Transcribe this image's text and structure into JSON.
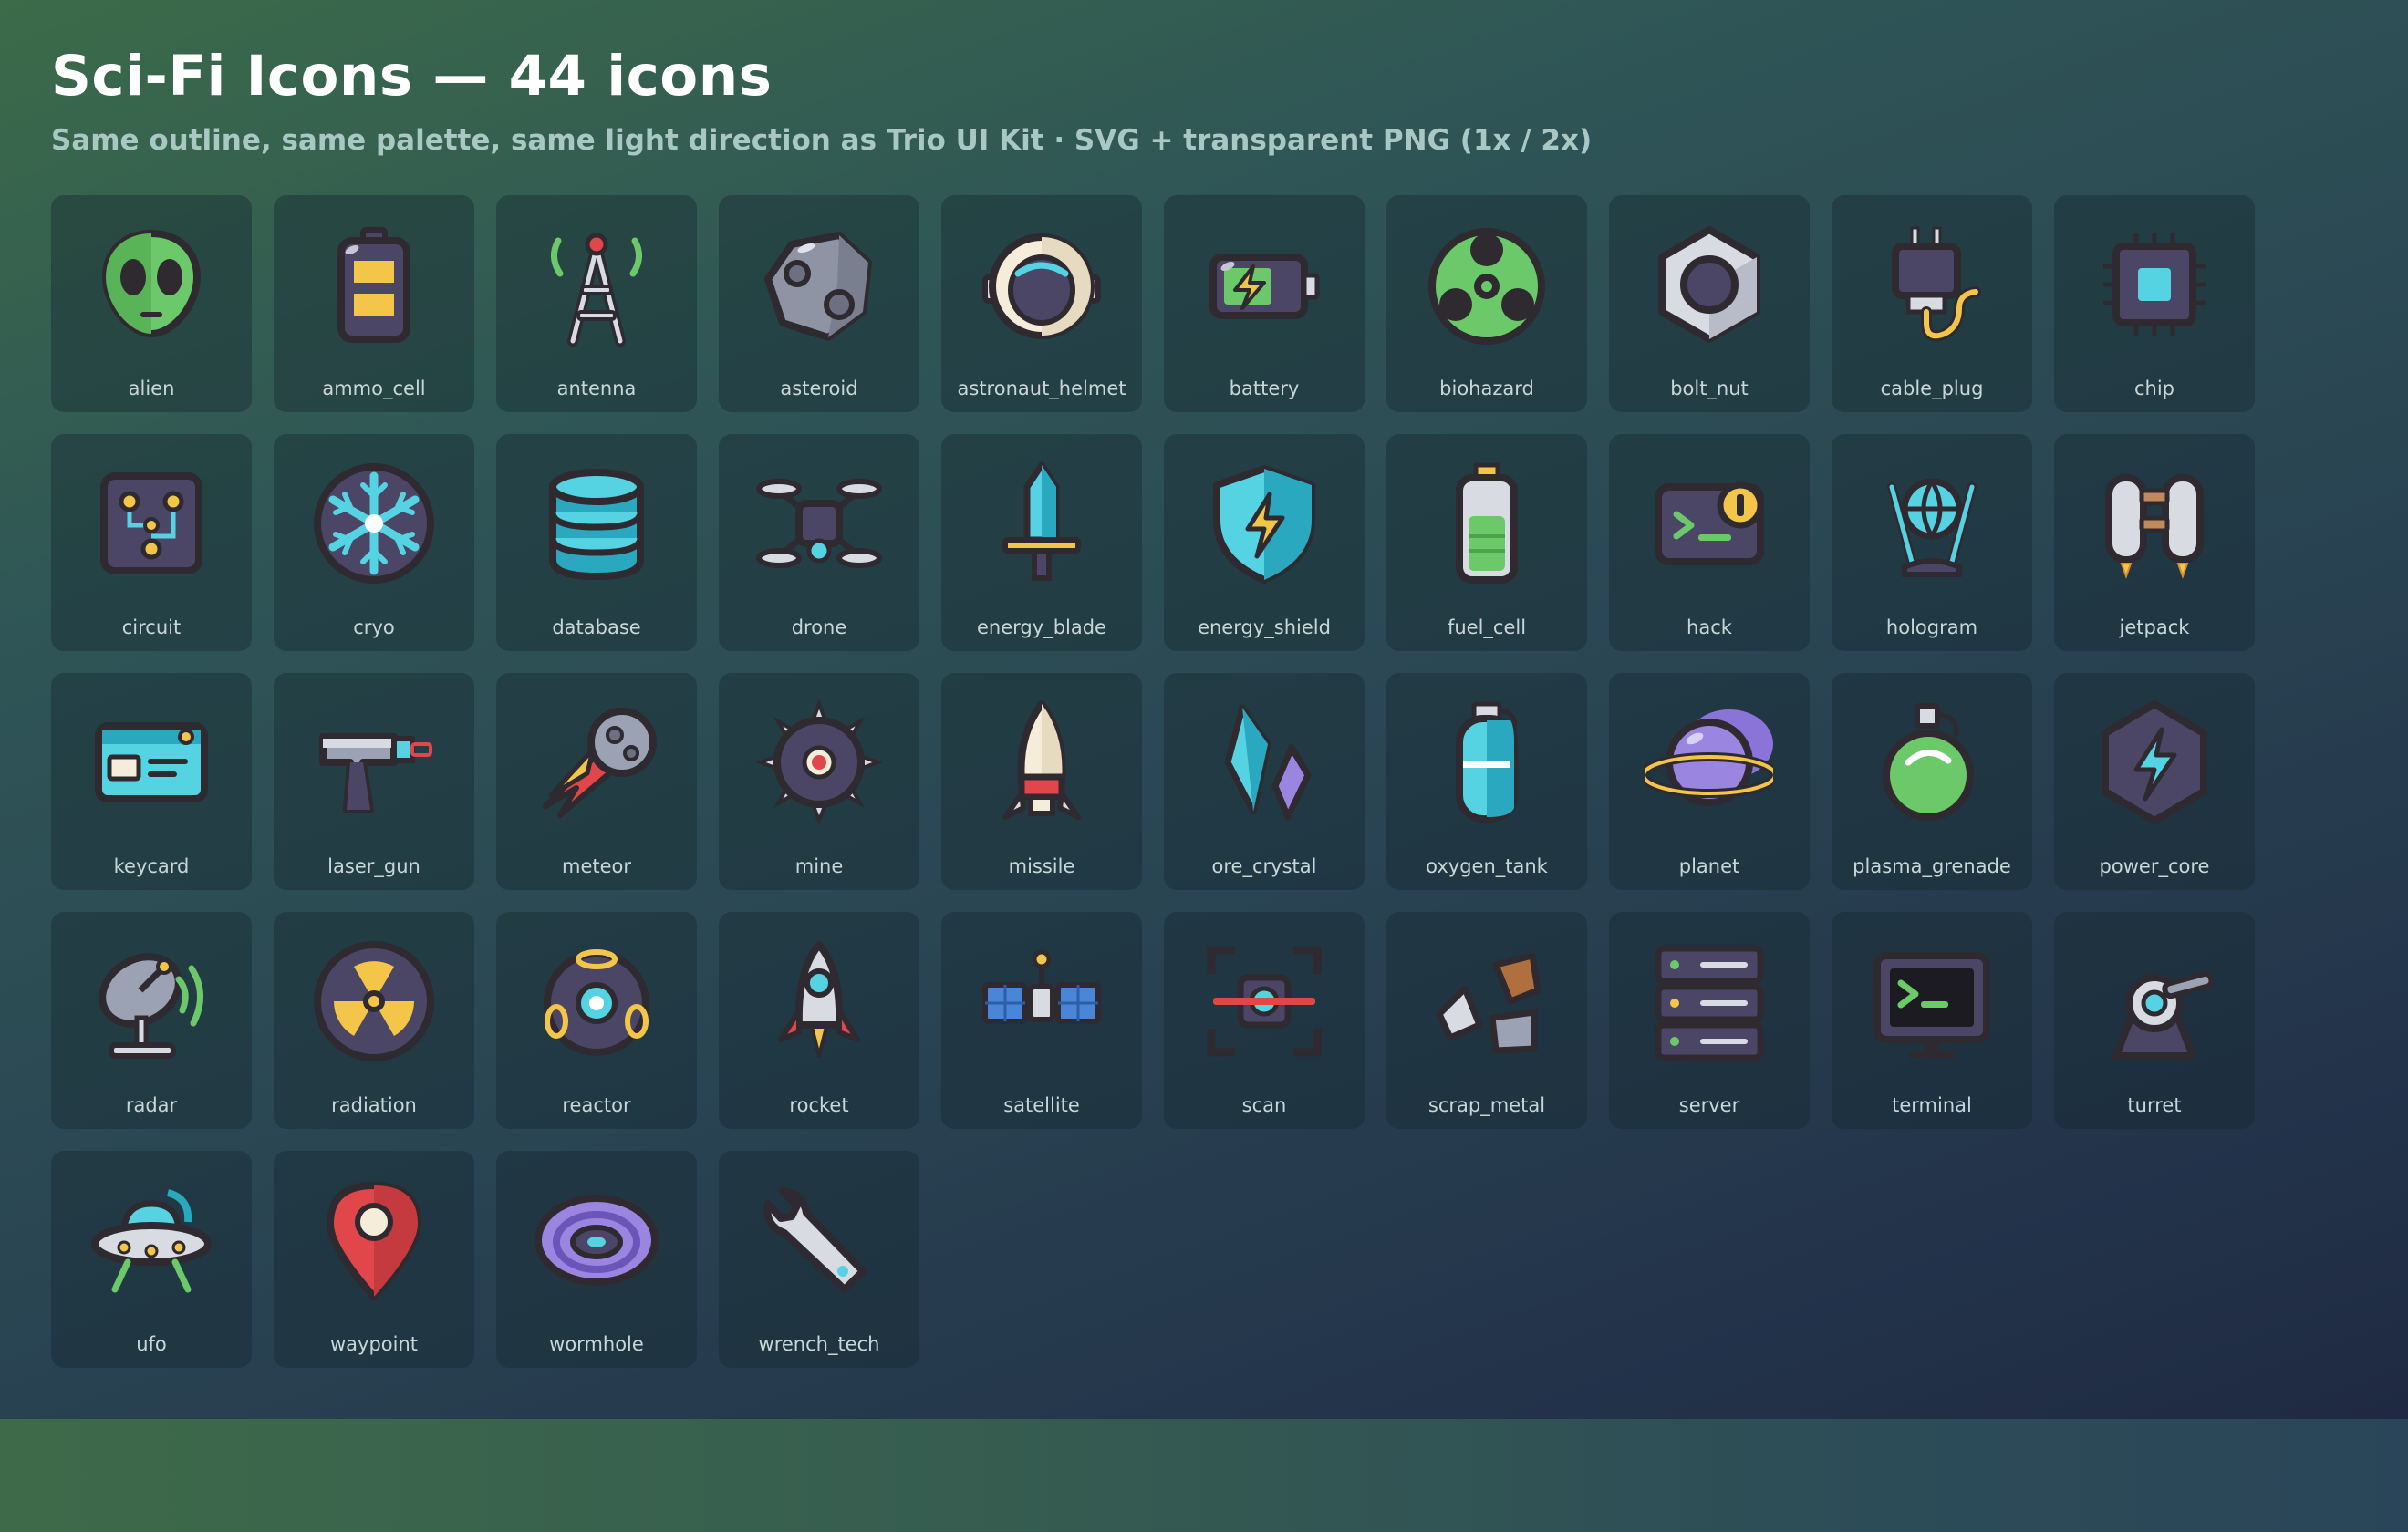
{
  "header": {
    "title": "Sci-Fi Icons — 44 icons",
    "subtitle": "Same outline, same palette, same light direction as Trio UI Kit · SVG + transparent PNG (1x / 2x)"
  },
  "icons": [
    {
      "label": "alien",
      "icon": "alien-icon"
    },
    {
      "label": "ammo_cell",
      "icon": "ammo-cell-icon"
    },
    {
      "label": "antenna",
      "icon": "antenna-icon"
    },
    {
      "label": "asteroid",
      "icon": "asteroid-icon"
    },
    {
      "label": "astronaut_helmet",
      "icon": "astronaut-helmet-icon"
    },
    {
      "label": "battery",
      "icon": "battery-icon"
    },
    {
      "label": "biohazard",
      "icon": "biohazard-icon"
    },
    {
      "label": "bolt_nut",
      "icon": "bolt-nut-icon"
    },
    {
      "label": "cable_plug",
      "icon": "cable-plug-icon"
    },
    {
      "label": "chip",
      "icon": "chip-icon"
    },
    {
      "label": "circuit",
      "icon": "circuit-icon"
    },
    {
      "label": "cryo",
      "icon": "cryo-icon"
    },
    {
      "label": "database",
      "icon": "database-icon"
    },
    {
      "label": "drone",
      "icon": "drone-icon"
    },
    {
      "label": "energy_blade",
      "icon": "energy-blade-icon"
    },
    {
      "label": "energy_shield",
      "icon": "energy-shield-icon"
    },
    {
      "label": "fuel_cell",
      "icon": "fuel-cell-icon"
    },
    {
      "label": "hack",
      "icon": "hack-icon"
    },
    {
      "label": "hologram",
      "icon": "hologram-icon"
    },
    {
      "label": "jetpack",
      "icon": "jetpack-icon"
    },
    {
      "label": "keycard",
      "icon": "keycard-icon"
    },
    {
      "label": "laser_gun",
      "icon": "laser-gun-icon"
    },
    {
      "label": "meteor",
      "icon": "meteor-icon"
    },
    {
      "label": "mine",
      "icon": "mine-icon"
    },
    {
      "label": "missile",
      "icon": "missile-icon"
    },
    {
      "label": "ore_crystal",
      "icon": "ore-crystal-icon"
    },
    {
      "label": "oxygen_tank",
      "icon": "oxygen-tank-icon"
    },
    {
      "label": "planet",
      "icon": "planet-icon"
    },
    {
      "label": "plasma_grenade",
      "icon": "plasma-grenade-icon"
    },
    {
      "label": "power_core",
      "icon": "power-core-icon"
    },
    {
      "label": "radar",
      "icon": "radar-icon"
    },
    {
      "label": "radiation",
      "icon": "radiation-icon"
    },
    {
      "label": "reactor",
      "icon": "reactor-icon"
    },
    {
      "label": "rocket",
      "icon": "rocket-icon"
    },
    {
      "label": "satellite",
      "icon": "satellite-icon"
    },
    {
      "label": "scan",
      "icon": "scan-icon"
    },
    {
      "label": "scrap_metal",
      "icon": "scrap-metal-icon"
    },
    {
      "label": "server",
      "icon": "server-icon"
    },
    {
      "label": "terminal",
      "icon": "terminal-icon"
    },
    {
      "label": "turret",
      "icon": "turret-icon"
    },
    {
      "label": "ufo",
      "icon": "ufo-icon"
    },
    {
      "label": "waypoint",
      "icon": "waypoint-icon"
    },
    {
      "label": "wormhole",
      "icon": "wormhole-icon"
    },
    {
      "label": "wrench_tech",
      "icon": "wrench-tech-icon"
    }
  ],
  "palette": {
    "outline": "#2e2a30",
    "green": "#6cc96a",
    "cyan": "#55d3e3",
    "yellow": "#f3c64a",
    "purple_dark": "#4b4566",
    "purple_light": "#9a85e0",
    "red": "#e0464a",
    "steel": "#9ba2b3",
    "cream": "#f5ecda"
  }
}
